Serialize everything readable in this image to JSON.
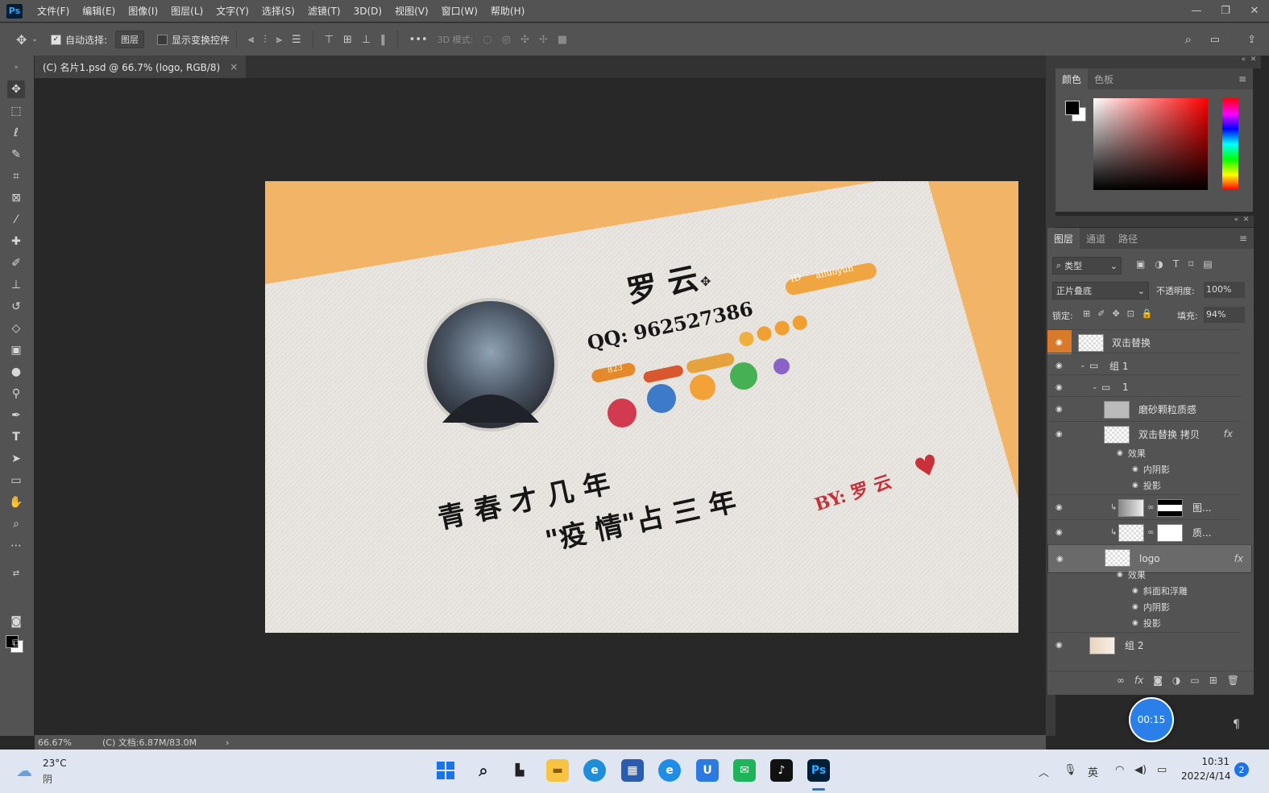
{
  "app": {
    "logo": "Ps"
  },
  "menu": [
    "文件(F)",
    "编辑(E)",
    "图像(I)",
    "图层(L)",
    "文字(Y)",
    "选择(S)",
    "滤镜(T)",
    "3D(D)",
    "视图(V)",
    "窗口(W)",
    "帮助(H)"
  ],
  "options": {
    "auto_select_label": "自动选择:",
    "auto_select_target": "图层",
    "show_transform_label": "显示变换控件",
    "mode_3d_label": "3D 模式:",
    "more": "•••"
  },
  "document": {
    "tab_title": "(C) 名片1.psd @ 66.7% (logo, RGB/8)",
    "close": "×"
  },
  "card": {
    "name": "罗 云",
    "qq": "QQ: 962527386",
    "id_label": "ID",
    "id_value": "ailuoyun",
    "level": "823",
    "slogan_line1": "青 春 才 几 年",
    "slogan_line2": "\"疫 情\"占 三 年",
    "by_line": "BY: 罗 云",
    "heart": "♥"
  },
  "status": {
    "zoom": "66.67%",
    "doc_info": "(C) 文档:6.87M/83.0M",
    "arrow": "›"
  },
  "color_panel": {
    "tabs": [
      "颜色",
      "色板"
    ],
    "fg": "#000000",
    "bg": "#ffffff",
    "hue": "#ff0000"
  },
  "layers_panel": {
    "tabs": [
      "图层",
      "通道",
      "路径"
    ],
    "filter_kind": "类型",
    "blend_mode": "正片叠底",
    "opacity_label": "不透明度:",
    "opacity": "100%",
    "lock_label": "锁定:",
    "fill_label": "填充:",
    "fill": "94%",
    "layers": [
      {
        "name": "双击替换",
        "fx": ""
      },
      {
        "name": "组 1",
        "fx": ""
      },
      {
        "name": "1",
        "fx": ""
      },
      {
        "name": "磨砂颗粒质感",
        "fx": ""
      },
      {
        "name": "双击替换 拷贝",
        "fx": "fx"
      },
      {
        "name": "图...",
        "fx": ""
      },
      {
        "name": "质...",
        "fx": ""
      },
      {
        "name": "logo",
        "fx": "fx"
      },
      {
        "name": "组 2",
        "fx": ""
      }
    ],
    "effects_a": {
      "title": "效果",
      "items": [
        "内阴影",
        "投影"
      ]
    },
    "effects_b": {
      "title": "效果",
      "items": [
        "斜面和浮雕",
        "内阴影",
        "投影"
      ]
    }
  },
  "timer": "00:15",
  "taskbar": {
    "weather_temp": "23°C",
    "weather_desc": "阴",
    "time": "10:31",
    "date": "2022/4/14",
    "ime": "英",
    "notification_count": "2",
    "ps_label": "Ps"
  }
}
